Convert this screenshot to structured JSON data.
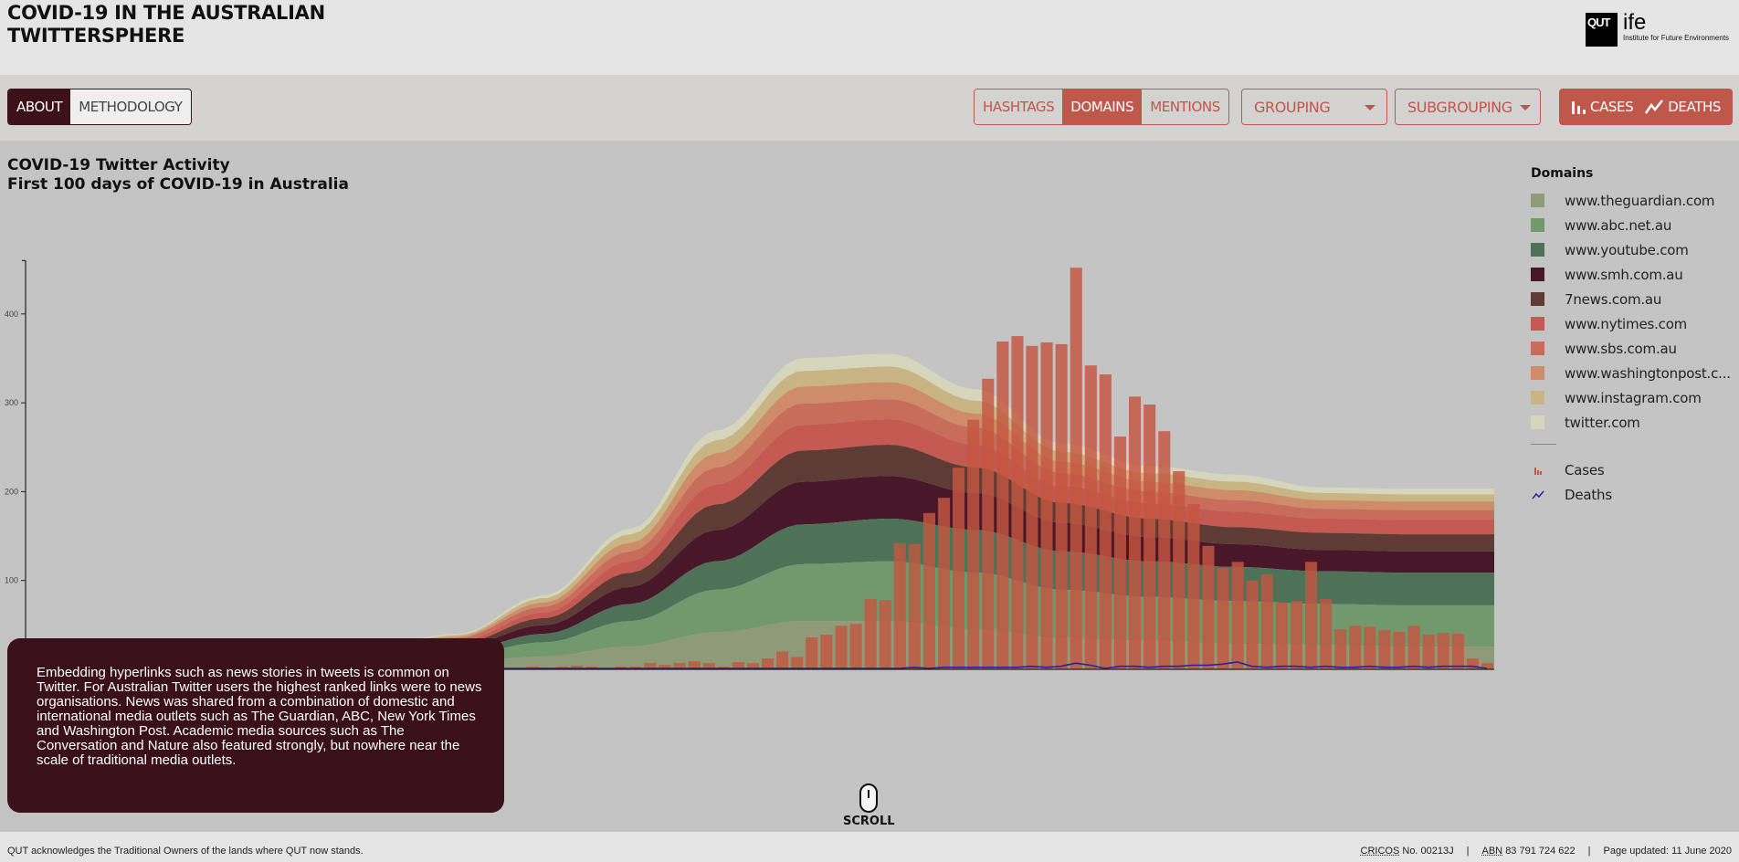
{
  "header": {
    "title_line1": "COVID-19 IN THE AUSTRALIAN",
    "title_line2": "TWITTERSPHERE",
    "logo": {
      "mark": "QUT",
      "name": "ife",
      "subtitle": "Institute for Future Environments"
    }
  },
  "toolbar": {
    "about_tabs": [
      {
        "label": "ABOUT",
        "active": true
      },
      {
        "label": "METHODOLOGY",
        "active": false
      }
    ],
    "type_tabs": [
      {
        "label": "HASHTAGS",
        "active": false
      },
      {
        "label": "DOMAINS",
        "active": true
      },
      {
        "label": "MENTIONS",
        "active": false
      }
    ],
    "grouping_label": "GROUPING",
    "subgrouping_label": "SUBGROUPING",
    "cases_label": "CASES",
    "deaths_label": "DEATHS"
  },
  "info_text": "Embedding hyperlinks such as news stories in tweets is common on Twitter. For Australian Twitter users the highest ranked links were to news organisations. News was shared from a combination of domestic and international media outlets such as The Guardian, ABC, New York Times and Washington Post. Academic media sources such as The Conversation and Nature also featured strongly, but nowhere near the scale of traditional media outlets.",
  "scroll_label": "SCROLL",
  "footer": {
    "acknowledgement": "QUT acknowledges the Traditional Owners of the lands where QUT now stands.",
    "cricos_abbr": "CRICOS",
    "cricos_text": "No. 00213J",
    "abn_abbr": "ABN",
    "abn_text": "83 791 724 622",
    "separator": "|",
    "updated": "Page updated: 11 June 2020"
  },
  "chart_data": {
    "type": "area",
    "subtype": "streamgraph with bar and line overlay",
    "title": "COVID-19 Twitter Activity",
    "subtitle": "First 100 days of COVID-19 in Australia",
    "xlabel": "",
    "ylabel": "",
    "days": 100,
    "ylim": [
      0,
      460
    ],
    "yticks": [
      100,
      200,
      300,
      400
    ],
    "legend_title": "Domains",
    "legend_position": "right",
    "series": [
      {
        "name": "www.theguardian.com",
        "color": "#8f9a78",
        "weights": [
          2,
          3,
          4,
          3,
          3,
          5,
          9,
          16,
          26,
          34,
          34,
          28,
          22,
          20,
          18,
          17,
          16,
          16
        ]
      },
      {
        "name": "www.abc.net.au",
        "color": "#72996e",
        "weights": [
          2,
          3,
          3,
          3,
          3,
          5,
          10,
          18,
          30,
          40,
          42,
          40,
          34,
          31,
          30,
          29,
          29,
          29
        ]
      },
      {
        "name": "www.youtube.com",
        "color": "#4e7258",
        "weights": [
          1,
          2,
          2,
          2,
          2,
          3,
          6,
          12,
          20,
          28,
          30,
          30,
          27,
          25,
          24,
          23,
          23,
          23
        ]
      },
      {
        "name": "www.smh.com.au",
        "color": "#48182a",
        "weights": [
          1,
          2,
          2,
          2,
          2,
          3,
          6,
          12,
          22,
          30,
          30,
          26,
          20,
          17,
          16,
          15,
          15,
          15
        ]
      },
      {
        "name": "7news.com.au",
        "color": "#5e3c35",
        "weights": [
          1,
          1,
          2,
          2,
          2,
          2,
          5,
          10,
          18,
          22,
          22,
          18,
          14,
          13,
          12,
          12,
          12,
          12
        ]
      },
      {
        "name": "www.nytimes.com",
        "color": "#c45a52",
        "weights": [
          1,
          1,
          2,
          1,
          1,
          2,
          4,
          8,
          14,
          18,
          18,
          16,
          12,
          11,
          11,
          10,
          10,
          10
        ]
      },
      {
        "name": "www.sbs.com.au",
        "color": "#c86c5c",
        "weights": [
          1,
          1,
          1,
          1,
          1,
          2,
          4,
          7,
          12,
          15,
          14,
          12,
          9,
          8,
          8,
          7,
          7,
          7
        ]
      },
      {
        "name": "www.washingtonpost.c...",
        "color": "#cf8c6a",
        "weights": [
          1,
          1,
          1,
          1,
          1,
          1,
          3,
          6,
          10,
          12,
          12,
          10,
          8,
          7,
          7,
          6,
          6,
          6
        ]
      },
      {
        "name": "www.instagram.com",
        "color": "#c9b484",
        "weights": [
          1,
          1,
          1,
          1,
          1,
          1,
          3,
          6,
          9,
          11,
          11,
          9,
          7,
          6,
          6,
          5,
          5,
          5
        ]
      },
      {
        "name": "twitter.com",
        "color": "#d6d6bc",
        "weights": [
          1,
          1,
          1,
          1,
          1,
          1,
          2,
          4,
          7,
          9,
          9,
          8,
          6,
          5,
          5,
          4,
          4,
          4
        ]
      }
    ],
    "cases": {
      "name": "Cases",
      "color": "#c4553f",
      "values": [
        0,
        0,
        0,
        0,
        0,
        0,
        0,
        0,
        0,
        0,
        0,
        0,
        0,
        0,
        0,
        0,
        0,
        0,
        0,
        0,
        0,
        0,
        0,
        0,
        0,
        0,
        0,
        0,
        0,
        0,
        0,
        0,
        0,
        0,
        3,
        2,
        3,
        4,
        3,
        1,
        3,
        3,
        7,
        5,
        7,
        9,
        7,
        3,
        8,
        7,
        12,
        20,
        14,
        36,
        39,
        49,
        51,
        79,
        78,
        142,
        141,
        176,
        193,
        227,
        281,
        327,
        369,
        375,
        364,
        368,
        366,
        452,
        342,
        332,
        262,
        307,
        298,
        268,
        223,
        186,
        139,
        114,
        121,
        100,
        107,
        75,
        77,
        121,
        79,
        45,
        49,
        48,
        44,
        42,
        49,
        39,
        41,
        40,
        12,
        7
      ]
    },
    "deaths": {
      "name": "Deaths",
      "color": "#2c1fa0",
      "values": [
        0,
        0,
        0,
        0,
        0,
        0,
        0,
        0,
        0,
        0,
        0,
        0,
        0,
        0,
        0,
        0,
        0,
        0,
        0,
        0,
        0,
        0,
        0,
        0,
        0,
        0,
        0,
        0,
        0,
        0,
        0,
        0,
        0,
        0,
        0,
        0,
        0,
        0,
        0,
        0,
        0,
        0,
        0,
        0,
        0,
        0,
        0,
        0,
        0,
        0,
        0,
        0,
        0,
        0,
        0,
        0,
        0,
        0,
        0,
        0,
        1,
        0,
        1,
        1,
        1,
        1,
        1,
        1,
        2,
        1,
        2,
        5,
        3,
        0,
        2,
        2,
        1,
        2,
        2,
        3,
        3,
        4,
        6,
        2,
        1,
        2,
        2,
        1,
        2,
        1,
        1,
        2,
        1,
        1,
        2,
        1,
        2,
        2,
        2,
        0
      ]
    }
  }
}
